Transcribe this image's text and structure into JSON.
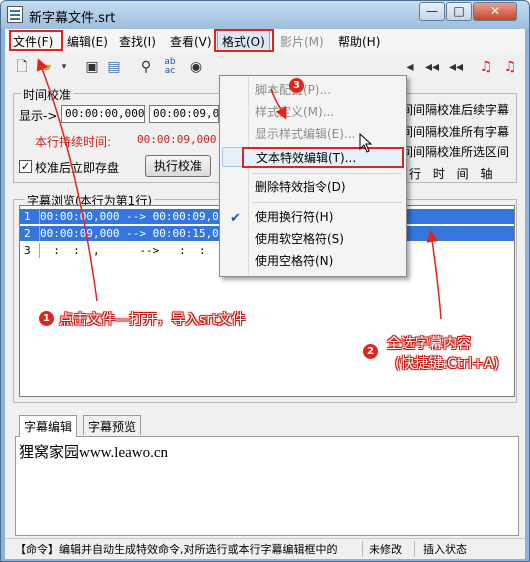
{
  "window": {
    "title": "新字幕文件.srt",
    "controls": {
      "minimize": "—",
      "maximize": "□",
      "close": "✕"
    }
  },
  "menubar": {
    "items": [
      {
        "label": "文件(F)",
        "highlighted": true
      },
      {
        "label": "编辑(E)"
      },
      {
        "label": "查找(I)"
      },
      {
        "label": "查看(V)"
      },
      {
        "label": "格式(O)",
        "open": true,
        "highlighted": true
      },
      {
        "label": "影片(M)",
        "disabled": true
      },
      {
        "label": "帮助(H)"
      }
    ]
  },
  "toolbar": {
    "icons": [
      "new-file-icon",
      "open-folder-icon",
      "dropdown-arrow-icon",
      "save-icon",
      "save-all-icon",
      "find-icon",
      "replace-icon",
      "zoom-icon",
      "seek-back-icon",
      "rewind-icon",
      "rewind-fast-icon",
      "music-note-icon",
      "music-note-2-icon"
    ]
  },
  "time_calibration": {
    "group_label": "时间校准",
    "display_label": "显示->",
    "start_time": "00:00:00,000",
    "end_time": "00:00:09,00",
    "duration_label": "本行持续时间:",
    "duration_value": "00:00:09,000",
    "checkbox_label": "校准后立即存盘",
    "checkbox_checked": true,
    "execute_button": "执行校准",
    "right_options": [
      "间间隔校准后续字幕",
      "间间隔校准所有字幕",
      "间间隔校准所选区间"
    ],
    "timeline_label": "行 时 间 轴"
  },
  "subtitle_browser": {
    "group_label": "字幕浏览(本行为第1行)",
    "rows": [
      {
        "num": "1",
        "text": "00:00:00,000 --> 00:00:09,00",
        "selected": true
      },
      {
        "num": "2",
        "text": "00:00:09,000 --> 00:00:15,00",
        "selected": true
      },
      {
        "num": "3",
        "text": "  :  :  ,      -->   :  :  ,",
        "selected": false
      }
    ]
  },
  "editor_tabs": {
    "tabs": [
      "字幕编辑",
      "字幕预览"
    ],
    "active": "字幕编辑",
    "content": "狸窝家园www.leawo.cn"
  },
  "format_menu": {
    "items": [
      {
        "label": "脚本配置(P)...",
        "disabled": true
      },
      {
        "label": "样式定义(M)...",
        "disabled": true
      },
      {
        "label": "显示样式编辑(E)...",
        "disabled": true
      },
      {
        "label": "文本特效编辑(T)...",
        "hover": true,
        "highlighted": true
      },
      {
        "label": "删除特效指令(D)"
      },
      {
        "label": "使用换行符(H)",
        "checked": true
      },
      {
        "label": "使用软空格符(S)"
      },
      {
        "label": "使用空格符(N)"
      }
    ]
  },
  "annotations": {
    "step1": {
      "number": "1",
      "text": "点击文件—打开，导入srt文件"
    },
    "step2": {
      "number": "2",
      "text": "全选字幕内容",
      "shortcut": "(快捷键:Ctrl+A)"
    },
    "step3": {
      "number": "3"
    }
  },
  "statusbar": {
    "command": "【命令】编辑并自动生成特效命令,对所选行或本行字幕编辑框中的",
    "modified": "未修改",
    "mode": "插入状态"
  },
  "colors": {
    "annotation_red": "#e0261c",
    "selection_blue": "#3377dd",
    "title_blue": "#9dbddd"
  }
}
